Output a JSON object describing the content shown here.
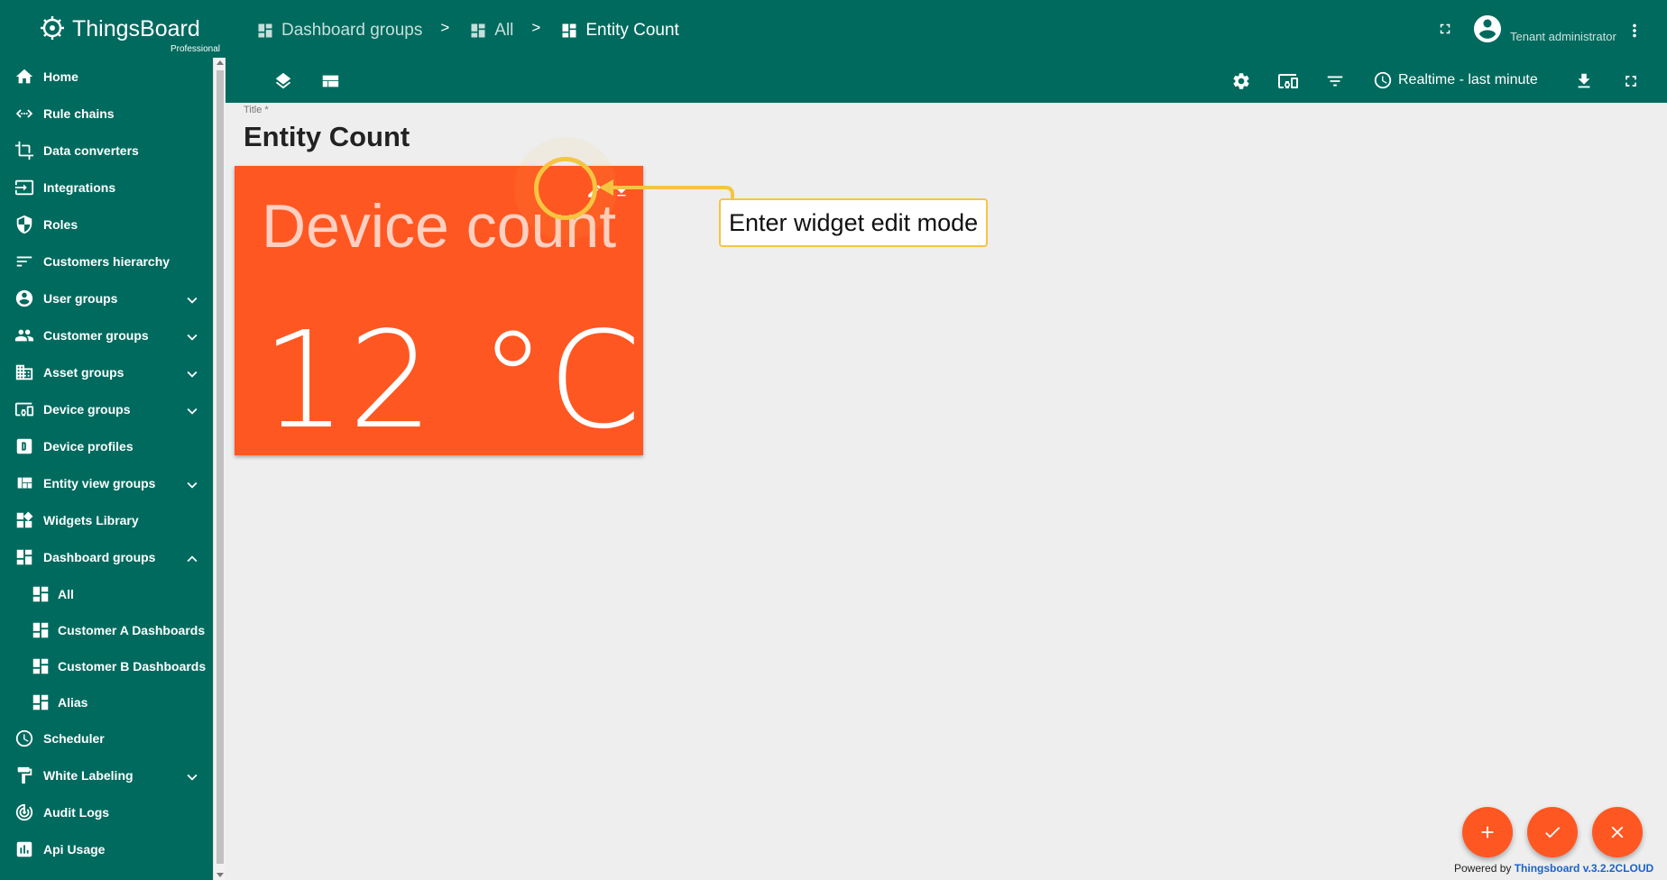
{
  "app": {
    "logo_title": "ThingsBoard",
    "logo_subtitle": "Professional"
  },
  "breadcrumb": [
    {
      "label": "Dashboard groups"
    },
    {
      "label": "All"
    },
    {
      "label": "Entity Count"
    }
  ],
  "breadcrumb_separator": ">",
  "user": {
    "role": "Tenant administrator"
  },
  "toolbar": {
    "timewindow_label": "Realtime - last minute"
  },
  "sidebar": {
    "items": [
      {
        "label": "Home",
        "icon": "home-icon"
      },
      {
        "label": "Rule chains",
        "icon": "rule-chains-icon"
      },
      {
        "label": "Data converters",
        "icon": "crop-icon"
      },
      {
        "label": "Integrations",
        "icon": "input-icon"
      },
      {
        "label": "Roles",
        "icon": "shield-icon"
      },
      {
        "label": "Customers hierarchy",
        "icon": "sort-icon"
      },
      {
        "label": "User groups",
        "icon": "account-circle-icon",
        "expandable": true
      },
      {
        "label": "Customer groups",
        "icon": "people-icon",
        "expandable": true
      },
      {
        "label": "Asset groups",
        "icon": "domain-icon",
        "expandable": true
      },
      {
        "label": "Device groups",
        "icon": "devices-icon",
        "expandable": true
      },
      {
        "label": "Device profiles",
        "icon": "device-profile-icon"
      },
      {
        "label": "Entity view groups",
        "icon": "view-quilt-icon",
        "expandable": true
      },
      {
        "label": "Widgets Library",
        "icon": "widgets-icon"
      },
      {
        "label": "Dashboard groups",
        "icon": "dashboard-icon",
        "expanded": true
      },
      {
        "label": "All",
        "icon": "dashboard-icon",
        "sub": true
      },
      {
        "label": "Customer A Dashboards",
        "icon": "dashboard-icon",
        "sub": true
      },
      {
        "label": "Customer B Dashboards",
        "icon": "dashboard-icon",
        "sub": true
      },
      {
        "label": "Alias",
        "icon": "dashboard-icon",
        "sub": true
      },
      {
        "label": "Scheduler",
        "icon": "schedule-icon"
      },
      {
        "label": "White Labeling",
        "icon": "format-paint-icon",
        "expandable": true
      },
      {
        "label": "Audit Logs",
        "icon": "track-changes-icon"
      },
      {
        "label": "Api Usage",
        "icon": "insert-chart-icon"
      }
    ]
  },
  "dashboard": {
    "title_label": "Title *",
    "title": "Entity Count"
  },
  "widget": {
    "title": "Device count",
    "value": "12",
    "unit": "°C",
    "color": "#ff5722"
  },
  "tooltip": {
    "text": "Enter widget edit mode",
    "color": "#f5c542"
  },
  "footer": {
    "powered_prefix": "Powered by",
    "powered_link": "Thingsboard v.3.2.2CLOUD"
  },
  "colors": {
    "primary": "#006a5e",
    "accent": "#ff5722",
    "background": "#eeeeee"
  }
}
